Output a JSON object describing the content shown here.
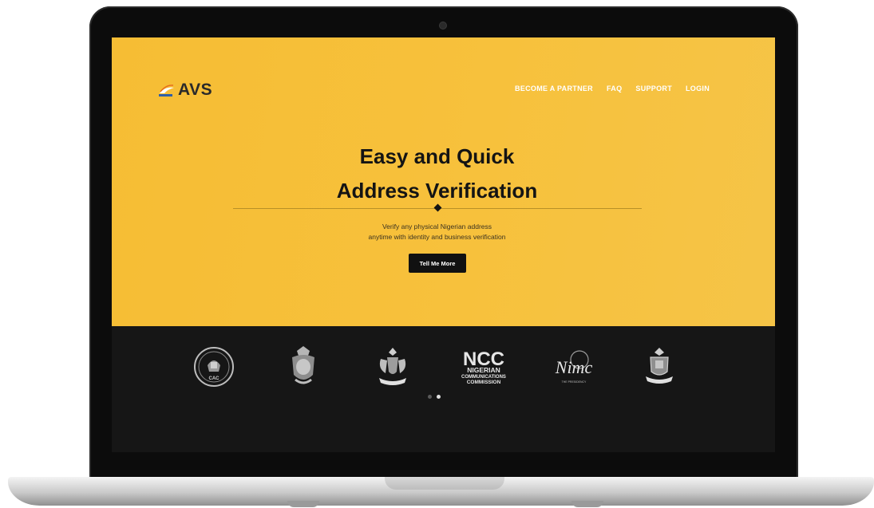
{
  "site": {
    "logo_text": "AVS",
    "nav": [
      "BECOME A PARTNER",
      "FAQ",
      "SUPPORT",
      "LOGIN"
    ],
    "headline_line1": "Easy and Quick",
    "headline_line2": "Address Verification",
    "subtext_line1": "Verify any physical Nigerian address",
    "subtext_line2": "anytime with identity and business verification",
    "cta_label": "Tell Me More"
  },
  "partners": {
    "logos": [
      "cac-seal-icon",
      "police-crest-icon",
      "coat-of-arms-icon",
      "ncc-logo-icon",
      "nimc-logo-icon",
      "university-crest-icon"
    ],
    "ncc_abbrev": "NCC",
    "ncc_line1": "NIGERIAN",
    "ncc_line2": "COMMUNICATIONS",
    "ncc_line3": "COMMISSION",
    "nimc_text": "Nimc",
    "nimc_caption": "THE PRESIDENCY",
    "cac_label": "CAC"
  },
  "carousel": {
    "pages": 2,
    "active_index": 1
  },
  "colors": {
    "hero_bg": "#f7c13c",
    "partners_bg": "#161616",
    "cta_bg": "#111111",
    "nav_text": "#ffffff"
  }
}
